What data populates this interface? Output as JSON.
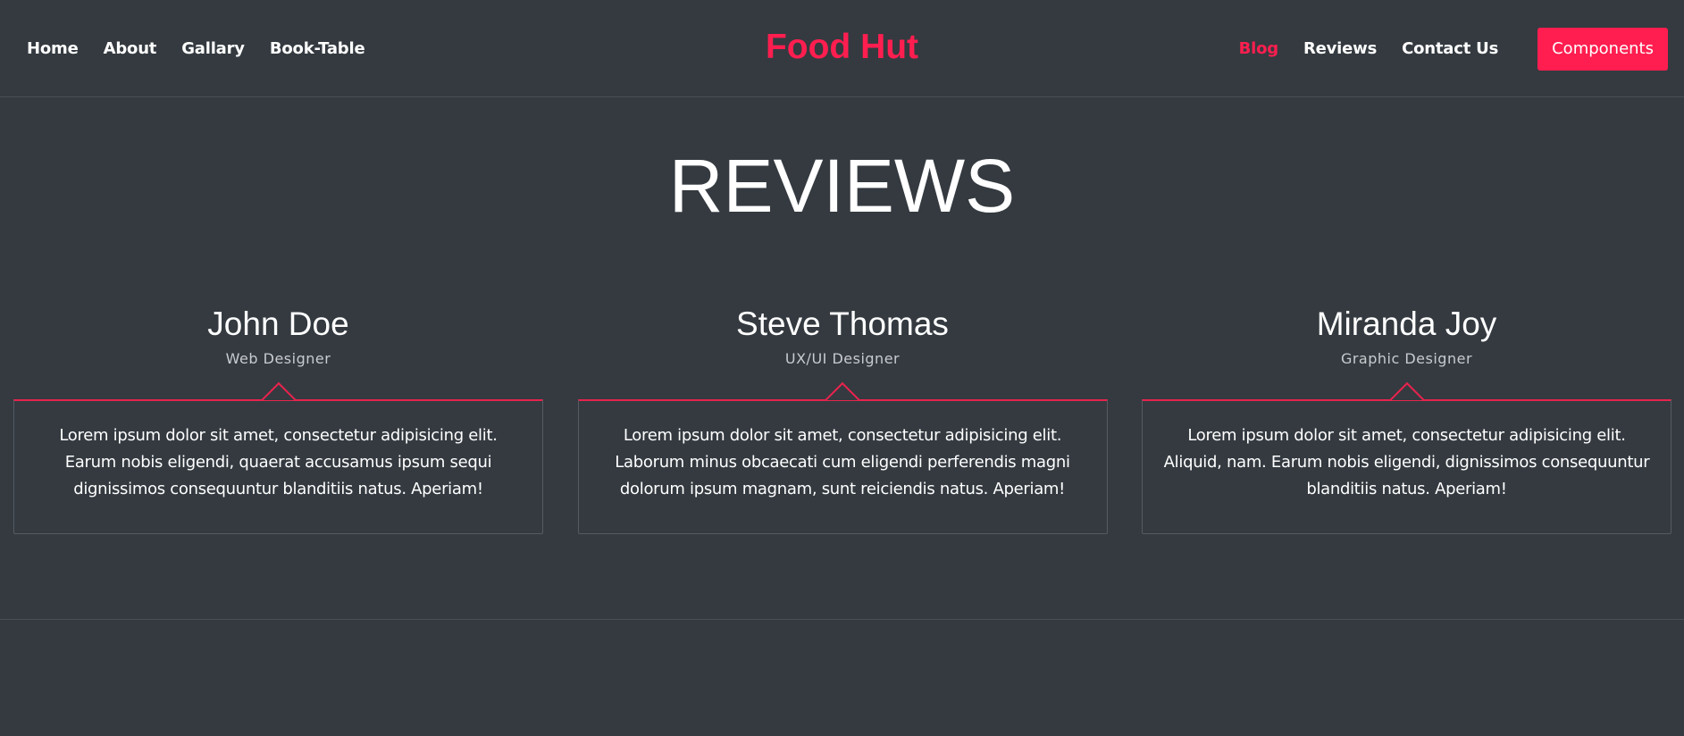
{
  "nav": {
    "left_links": [
      "Home",
      "About",
      "Gallary",
      "Book-Table"
    ],
    "brand": "Food Hut",
    "right_links": [
      "Blog",
      "Reviews",
      "Contact Us"
    ],
    "active_link": "Blog",
    "button_label": "Components"
  },
  "section": {
    "title": "REVIEWS"
  },
  "reviews": [
    {
      "name": "John Doe",
      "role": "Web Designer",
      "text": "Lorem ipsum dolor sit amet, consectetur adipisicing elit. Earum nobis eligendi, quaerat accusamus ipsum sequi dignissimos consequuntur blanditiis natus. Aperiam!"
    },
    {
      "name": "Steve Thomas",
      "role": "UX/UI Designer",
      "text": "Lorem ipsum dolor sit amet, consectetur adipisicing elit. Laborum minus obcaecati cum eligendi perferendis magni dolorum ipsum magnam, sunt reiciendis natus. Aperiam!"
    },
    {
      "name": "Miranda Joy",
      "role": "Graphic Designer",
      "text": "Lorem ipsum dolor sit amet, consectetur adipisicing elit. Aliquid, nam. Earum nobis eligendi, dignissimos consequuntur blanditiis natus. Aperiam!"
    }
  ],
  "colors": {
    "background": "#343a40",
    "accent": "#ff1e4f",
    "text": "#ffffff",
    "muted_text": "#c8cbcf",
    "border": "#555b62"
  }
}
